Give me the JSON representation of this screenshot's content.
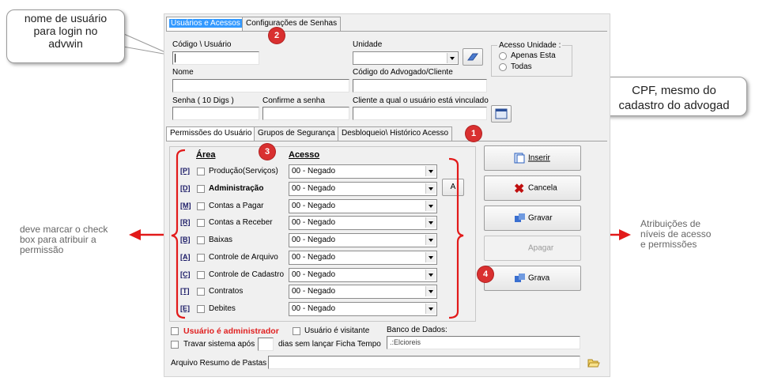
{
  "tabs_top": {
    "users": "Usuários e Acessos",
    "passwords": "Configurações de Senhas"
  },
  "fields": {
    "codigo_label": "Código \\ Usuário",
    "unidade_label": "Unidade",
    "acesso_unidade_label": "Acesso Unidade :",
    "apenas_esta": "Apenas Esta",
    "todas": "Todas",
    "nome_label": "Nome",
    "codigo_advogado_label": "Código do Advogado/Cliente",
    "senha_label": "Senha ( 10 Digs )",
    "confirme_label": "Confirme a senha",
    "cliente_label": "Cliente a qual o usuário está vinculado"
  },
  "tabs_inner": {
    "perm": "Permissões do Usuário",
    "grupos": "Grupos de Segurança",
    "desbloqueio": "Desbloqueio\\ Histórico Acesso"
  },
  "grid": {
    "area_header": "Área",
    "acesso_header": "Acesso",
    "a_button": "A",
    "rows": [
      {
        "key": "[P]",
        "label": "Produção(Serviços)",
        "value": "00 - Negado"
      },
      {
        "key": "[D]",
        "label": "Administração",
        "value": "00 - Negado"
      },
      {
        "key": "[M]",
        "label": "Contas a Pagar",
        "value": "00 - Negado"
      },
      {
        "key": "[R]",
        "label": "Contas a Receber",
        "value": "00 - Negado"
      },
      {
        "key": "[B]",
        "label": "Baixas",
        "value": "00 - Negado"
      },
      {
        "key": "[A]",
        "label": "Controle de Arquivo",
        "value": "00 - Negado"
      },
      {
        "key": "[C]",
        "label": "Controle de Cadastro",
        "value": "00 - Negado"
      },
      {
        "key": "[T]",
        "label": "Contratos",
        "value": "00 - Negado"
      },
      {
        "key": "[E]",
        "label": "Debites",
        "value": "00 - Negado"
      }
    ]
  },
  "buttons": {
    "inserir": "Inserir",
    "cancela": "Cancela",
    "gravar": "Gravar",
    "apagar": "Apagar",
    "grava": "Grava"
  },
  "bottom": {
    "admin": "Usuário é administrador",
    "visitante": "Usuário é visitante",
    "banco_label": "Banco de Dados:",
    "banco_value": ".:Elcioreis",
    "travar": "Travar sistema após",
    "dias": "dias sem lançar Ficha Tempo",
    "arquivo": "Arquivo Resumo de Pastas"
  },
  "annotations": {
    "login_callout": "nome de usuário\npara login no\nadvwin",
    "cpf_callout": "CPF, mesmo do\ncadastro do advogad",
    "left_note": "deve marcar o check\nbox para atribuir a\npermissão",
    "right_note": "Atribuições de\nníveis de acesso\ne permissões",
    "badge1": "1",
    "badge2": "2",
    "badge3": "3",
    "badge4": "4"
  },
  "colors": {
    "admin_red": "#e02020",
    "annotation_red": "#e21a1a",
    "selection_blue": "#3399ff"
  }
}
